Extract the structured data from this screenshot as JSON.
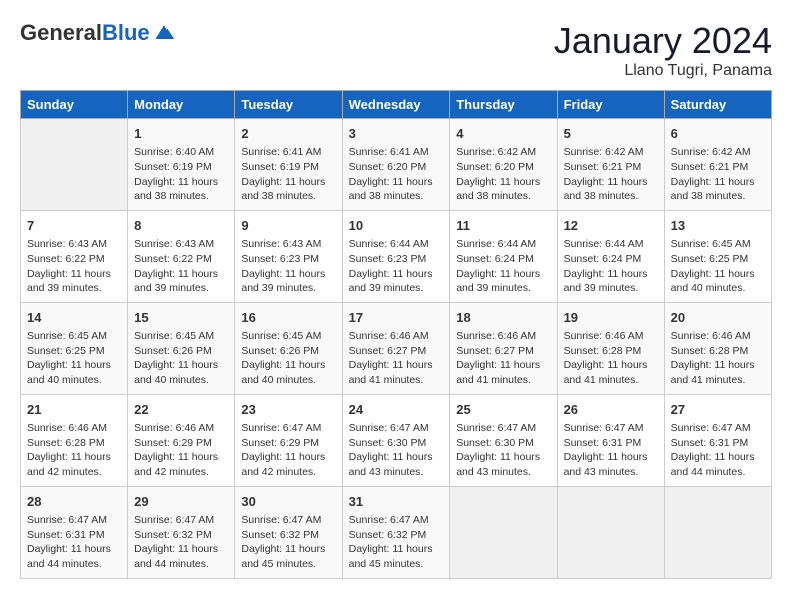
{
  "header": {
    "logo_general": "General",
    "logo_blue": "Blue",
    "month_title": "January 2024",
    "subtitle": "Llano Tugri, Panama"
  },
  "days_of_week": [
    "Sunday",
    "Monday",
    "Tuesday",
    "Wednesday",
    "Thursday",
    "Friday",
    "Saturday"
  ],
  "weeks": [
    [
      {
        "num": "",
        "info": ""
      },
      {
        "num": "1",
        "info": "Sunrise: 6:40 AM\nSunset: 6:19 PM\nDaylight: 11 hours\nand 38 minutes."
      },
      {
        "num": "2",
        "info": "Sunrise: 6:41 AM\nSunset: 6:19 PM\nDaylight: 11 hours\nand 38 minutes."
      },
      {
        "num": "3",
        "info": "Sunrise: 6:41 AM\nSunset: 6:20 PM\nDaylight: 11 hours\nand 38 minutes."
      },
      {
        "num": "4",
        "info": "Sunrise: 6:42 AM\nSunset: 6:20 PM\nDaylight: 11 hours\nand 38 minutes."
      },
      {
        "num": "5",
        "info": "Sunrise: 6:42 AM\nSunset: 6:21 PM\nDaylight: 11 hours\nand 38 minutes."
      },
      {
        "num": "6",
        "info": "Sunrise: 6:42 AM\nSunset: 6:21 PM\nDaylight: 11 hours\nand 38 minutes."
      }
    ],
    [
      {
        "num": "7",
        "info": "Sunrise: 6:43 AM\nSunset: 6:22 PM\nDaylight: 11 hours\nand 39 minutes."
      },
      {
        "num": "8",
        "info": "Sunrise: 6:43 AM\nSunset: 6:22 PM\nDaylight: 11 hours\nand 39 minutes."
      },
      {
        "num": "9",
        "info": "Sunrise: 6:43 AM\nSunset: 6:23 PM\nDaylight: 11 hours\nand 39 minutes."
      },
      {
        "num": "10",
        "info": "Sunrise: 6:44 AM\nSunset: 6:23 PM\nDaylight: 11 hours\nand 39 minutes."
      },
      {
        "num": "11",
        "info": "Sunrise: 6:44 AM\nSunset: 6:24 PM\nDaylight: 11 hours\nand 39 minutes."
      },
      {
        "num": "12",
        "info": "Sunrise: 6:44 AM\nSunset: 6:24 PM\nDaylight: 11 hours\nand 39 minutes."
      },
      {
        "num": "13",
        "info": "Sunrise: 6:45 AM\nSunset: 6:25 PM\nDaylight: 11 hours\nand 40 minutes."
      }
    ],
    [
      {
        "num": "14",
        "info": "Sunrise: 6:45 AM\nSunset: 6:25 PM\nDaylight: 11 hours\nand 40 minutes."
      },
      {
        "num": "15",
        "info": "Sunrise: 6:45 AM\nSunset: 6:26 PM\nDaylight: 11 hours\nand 40 minutes."
      },
      {
        "num": "16",
        "info": "Sunrise: 6:45 AM\nSunset: 6:26 PM\nDaylight: 11 hours\nand 40 minutes."
      },
      {
        "num": "17",
        "info": "Sunrise: 6:46 AM\nSunset: 6:27 PM\nDaylight: 11 hours\nand 41 minutes."
      },
      {
        "num": "18",
        "info": "Sunrise: 6:46 AM\nSunset: 6:27 PM\nDaylight: 11 hours\nand 41 minutes."
      },
      {
        "num": "19",
        "info": "Sunrise: 6:46 AM\nSunset: 6:28 PM\nDaylight: 11 hours\nand 41 minutes."
      },
      {
        "num": "20",
        "info": "Sunrise: 6:46 AM\nSunset: 6:28 PM\nDaylight: 11 hours\nand 41 minutes."
      }
    ],
    [
      {
        "num": "21",
        "info": "Sunrise: 6:46 AM\nSunset: 6:28 PM\nDaylight: 11 hours\nand 42 minutes."
      },
      {
        "num": "22",
        "info": "Sunrise: 6:46 AM\nSunset: 6:29 PM\nDaylight: 11 hours\nand 42 minutes."
      },
      {
        "num": "23",
        "info": "Sunrise: 6:47 AM\nSunset: 6:29 PM\nDaylight: 11 hours\nand 42 minutes."
      },
      {
        "num": "24",
        "info": "Sunrise: 6:47 AM\nSunset: 6:30 PM\nDaylight: 11 hours\nand 43 minutes."
      },
      {
        "num": "25",
        "info": "Sunrise: 6:47 AM\nSunset: 6:30 PM\nDaylight: 11 hours\nand 43 minutes."
      },
      {
        "num": "26",
        "info": "Sunrise: 6:47 AM\nSunset: 6:31 PM\nDaylight: 11 hours\nand 43 minutes."
      },
      {
        "num": "27",
        "info": "Sunrise: 6:47 AM\nSunset: 6:31 PM\nDaylight: 11 hours\nand 44 minutes."
      }
    ],
    [
      {
        "num": "28",
        "info": "Sunrise: 6:47 AM\nSunset: 6:31 PM\nDaylight: 11 hours\nand 44 minutes."
      },
      {
        "num": "29",
        "info": "Sunrise: 6:47 AM\nSunset: 6:32 PM\nDaylight: 11 hours\nand 44 minutes."
      },
      {
        "num": "30",
        "info": "Sunrise: 6:47 AM\nSunset: 6:32 PM\nDaylight: 11 hours\nand 45 minutes."
      },
      {
        "num": "31",
        "info": "Sunrise: 6:47 AM\nSunset: 6:32 PM\nDaylight: 11 hours\nand 45 minutes."
      },
      {
        "num": "",
        "info": ""
      },
      {
        "num": "",
        "info": ""
      },
      {
        "num": "",
        "info": ""
      }
    ]
  ]
}
